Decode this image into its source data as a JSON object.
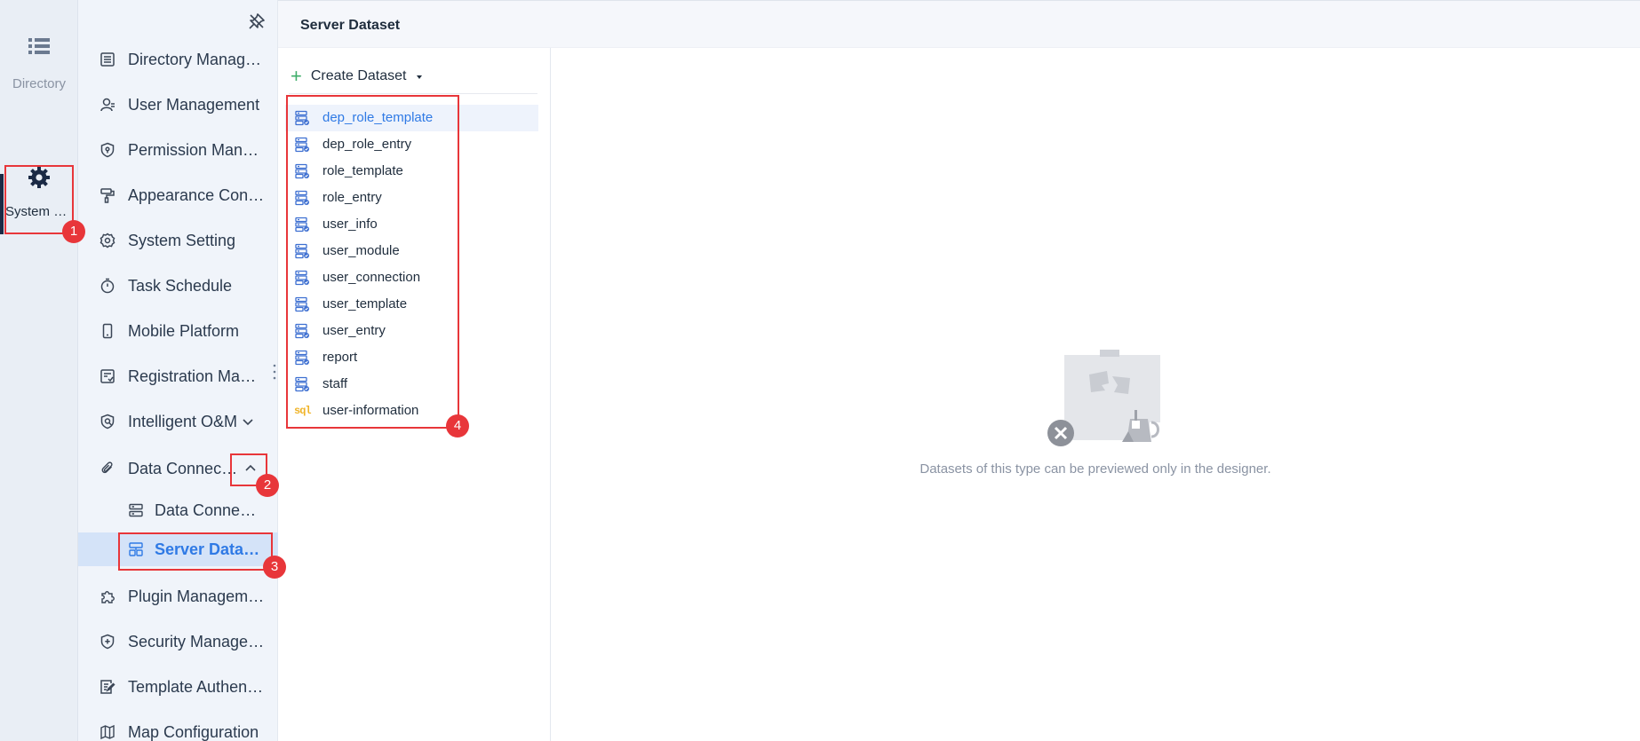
{
  "rail": {
    "directory_label": "Directory",
    "system_label": "System Management"
  },
  "submenu": {
    "items": [
      {
        "label": "Directory Management",
        "icon": "list-doc-icon"
      },
      {
        "label": "User Management",
        "icon": "user-icon"
      },
      {
        "label": "Permission Management",
        "icon": "shield-lock-icon"
      },
      {
        "label": "Appearance Configuration",
        "icon": "paint-roller-icon"
      },
      {
        "label": "System Setting",
        "icon": "gear-icon"
      },
      {
        "label": "Task Schedule",
        "icon": "stopwatch-icon"
      },
      {
        "label": "Mobile Platform",
        "icon": "mobile-icon"
      },
      {
        "label": "Registration Management",
        "icon": "registration-icon"
      },
      {
        "label": "Intelligent O&M",
        "icon": "om-icon"
      },
      {
        "label": "Data Connection",
        "icon": "paperclip-icon"
      }
    ],
    "sub_items": [
      {
        "label": "Data Connection Management",
        "icon": "server-icon"
      },
      {
        "label": "Server Dataset",
        "icon": "dataset-icon"
      }
    ],
    "items_after": [
      {
        "label": "Plugin Management",
        "icon": "puzzle-icon"
      },
      {
        "label": "Security Management",
        "icon": "shield-plus-icon"
      },
      {
        "label": "Template Authentication",
        "icon": "template-auth-icon"
      },
      {
        "label": "Map Configuration",
        "icon": "map-icon"
      }
    ]
  },
  "header": {
    "title": "Server Dataset"
  },
  "datasets": {
    "create_label": "Create Dataset",
    "items": [
      {
        "name": "dep_role_template",
        "type": "db"
      },
      {
        "name": "dep_role_entry",
        "type": "db"
      },
      {
        "name": "role_template",
        "type": "db"
      },
      {
        "name": "role_entry",
        "type": "db"
      },
      {
        "name": "user_info",
        "type": "db"
      },
      {
        "name": "user_module",
        "type": "db"
      },
      {
        "name": "user_connection",
        "type": "db"
      },
      {
        "name": "user_template",
        "type": "db"
      },
      {
        "name": "user_entry",
        "type": "db"
      },
      {
        "name": "report",
        "type": "db"
      },
      {
        "name": "staff",
        "type": "db"
      },
      {
        "name": "user-information",
        "type": "sql"
      }
    ],
    "sql_tag": "sql"
  },
  "preview": {
    "empty_text": "Datasets of this type can be previewed only in the designer."
  },
  "annotations": {
    "badges": [
      "1",
      "2",
      "3",
      "4"
    ]
  },
  "colors": {
    "accent": "#2f7ae5",
    "highlight": "#e8363a",
    "rail_bg": "#e9eef5",
    "submenu_bg": "#f0f4fa"
  }
}
